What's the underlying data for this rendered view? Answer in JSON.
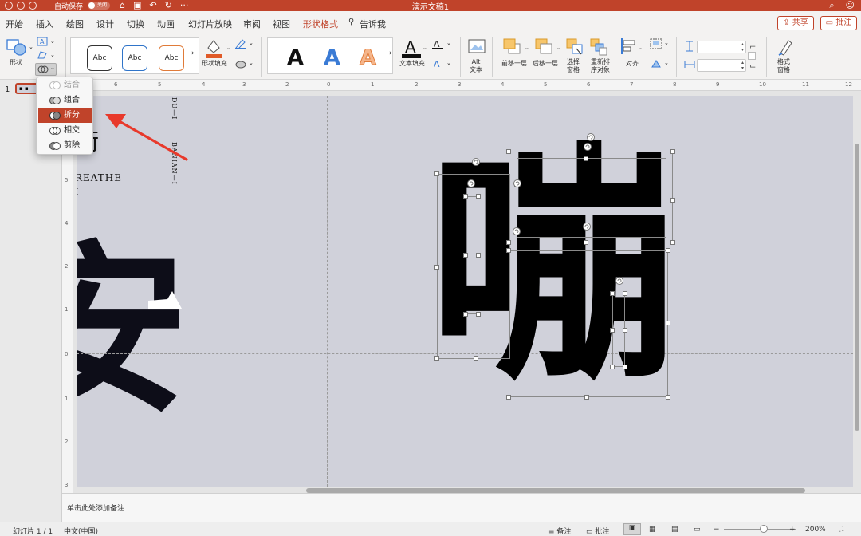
{
  "titlebar": {
    "autosave_label": "自动保存",
    "autosave_state": "关闭",
    "doc_title": "演示文稿1"
  },
  "menubar": {
    "tabs": [
      {
        "label": "开始"
      },
      {
        "label": "插入"
      },
      {
        "label": "绘图"
      },
      {
        "label": "设计"
      },
      {
        "label": "切换"
      },
      {
        "label": "动画"
      },
      {
        "label": "幻灯片放映"
      },
      {
        "label": "审阅"
      },
      {
        "label": "视图"
      },
      {
        "label": "形状格式",
        "active": true
      },
      {
        "label": "告诉我"
      }
    ],
    "share_label": "共享",
    "comment_label": "批注"
  },
  "ribbon": {
    "shape_label": "形状",
    "style_samples": [
      "Abc",
      "Abc",
      "Abc"
    ],
    "style_sample_colors": [
      "#333333",
      "#2f74c9",
      "#e07b39"
    ],
    "shape_fill_label": "形状填充",
    "wordart_samples": [
      "A",
      "A",
      "A"
    ],
    "wordart_colors": [
      "#111111",
      "#3a7bd5",
      "#f0a060"
    ],
    "text_fill_label": "文本填充",
    "alt_text_label": "Alt\n文本",
    "bring_forward_label": "前移一层",
    "send_backward_label": "后移一层",
    "selection_pane_label": "选择\n窗格",
    "reorder_label": "重新排\n序对象",
    "align_label": "对齐",
    "format_pane_label": "格式\n窗格",
    "accent_color": "#c0432a"
  },
  "merge_menu": {
    "items": [
      {
        "label": "结合",
        "disabled": true
      },
      {
        "label": "组合"
      },
      {
        "label": "拆分",
        "selected": true
      },
      {
        "label": "相交"
      },
      {
        "label": "剪除"
      }
    ]
  },
  "thumbs": {
    "slide_number": "1"
  },
  "slide": {
    "big_char_left": "安",
    "small_chars": "術",
    "breathe_text": "REATHE",
    "small_i": "I",
    "vertical_text_1": "DU—I",
    "vertical_text_2": "BANIAN—I",
    "big_char_right": "嘣",
    "background_color": "#d0d1da"
  },
  "notes": {
    "placeholder": "单击此处添加备注"
  },
  "status": {
    "slide_counter": "幻灯片 1 / 1",
    "language": "中文(中国)",
    "notes_label": "备注",
    "comments_label": "批注",
    "zoom_level": "200%",
    "zoom_fraction": 0.55
  }
}
